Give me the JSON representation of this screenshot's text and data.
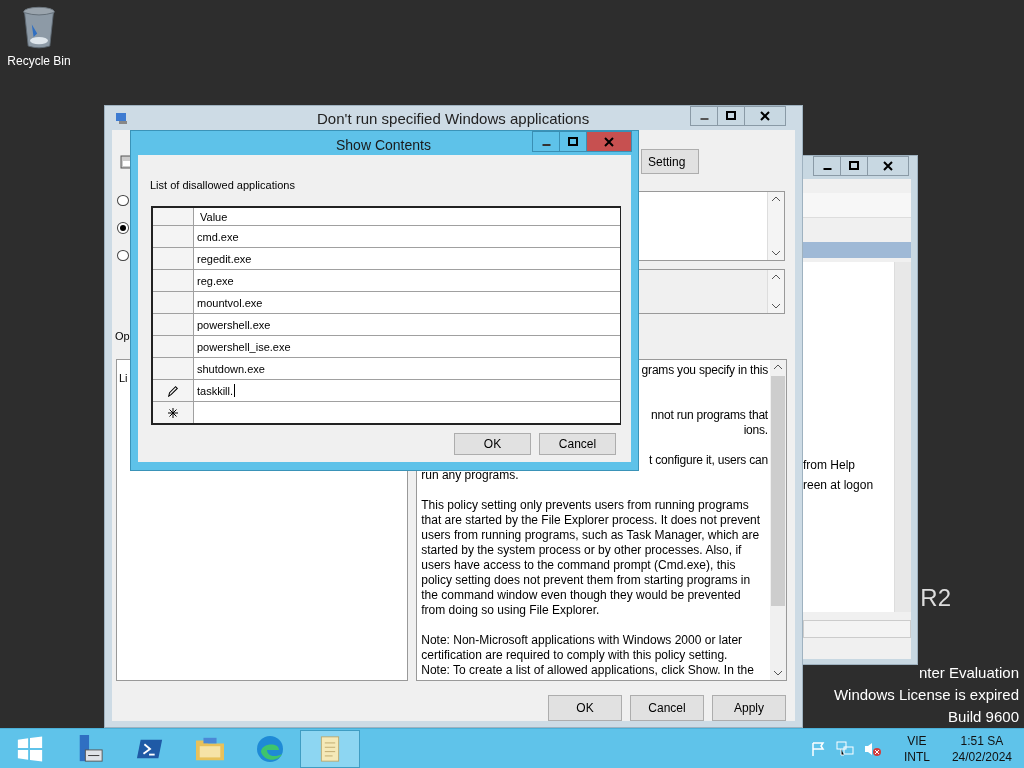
{
  "desktop": {
    "icons": [
      {
        "label": "Recycle Bin"
      }
    ],
    "os_notice": {
      "edition_tail": "R2",
      "edition": "nter Evaluation",
      "license": "Windows License is expired",
      "build": "Build 9600"
    }
  },
  "back_window": {
    "lines": [
      "from Help",
      "reen at logon"
    ]
  },
  "policy_window": {
    "title": "Don't run specified Windows applications",
    "setting_button": "Setting",
    "radios": [
      {
        "selected": false
      },
      {
        "selected": true
      },
      {
        "selected": false
      }
    ],
    "options_label": "Op",
    "options_text": "Li",
    "help_paragraphs": [
      {
        "lines": [
          {
            "text": "grams you specify in this",
            "cut": true
          }
        ]
      },
      {
        "lines": [
          {
            "text": "nnot run programs that",
            "cut": true
          },
          {
            "text": "ions.",
            "cut": true
          }
        ]
      },
      {
        "lines": [
          {
            "text": "t configure it, users can",
            "cut": true
          },
          {
            "text": "run any programs.",
            "cut": false
          }
        ]
      },
      {
        "lines": [
          {
            "text": "This policy setting only prevents users from running programs",
            "cut": false
          },
          {
            "text": "that are started by the File Explorer process. It does not prevent",
            "cut": false
          },
          {
            "text": "users from running programs, such as Task Manager, which are",
            "cut": false
          },
          {
            "text": "started by the system process or by other processes.  Also, if",
            "cut": false
          },
          {
            "text": "users have access to the command prompt (Cmd.exe), this",
            "cut": false
          },
          {
            "text": "policy setting does not prevent them from starting programs in",
            "cut": false
          },
          {
            "text": "the command window even though they would be prevented",
            "cut": false
          },
          {
            "text": "from doing so using File Explorer.",
            "cut": false
          }
        ]
      },
      {
        "lines": [
          {
            "text": "Note: Non-Microsoft applications with Windows 2000 or later",
            "cut": false
          },
          {
            "text": "certification are required to comply with this policy setting.",
            "cut": false
          },
          {
            "text": "Note: To create a list of allowed applications, click Show.  In the",
            "cut": false
          }
        ]
      }
    ],
    "buttons": [
      "OK",
      "Cancel",
      "Apply"
    ]
  },
  "dialog": {
    "title": "Show Contents",
    "label": "List of disallowed applications",
    "column": "Value",
    "rows": [
      {
        "value": "cmd.exe",
        "editing": false
      },
      {
        "value": "regedit.exe",
        "editing": false
      },
      {
        "value": "reg.exe",
        "editing": false
      },
      {
        "value": "mountvol.exe",
        "editing": false
      },
      {
        "value": "powershell.exe",
        "editing": false
      },
      {
        "value": "powershell_ise.exe",
        "editing": false
      },
      {
        "value": "shutdown.exe",
        "editing": false
      },
      {
        "value": "taskkill.",
        "editing": true
      }
    ],
    "new_row": true,
    "buttons": [
      "OK",
      "Cancel"
    ]
  },
  "taskbar": {
    "apps": [
      {
        "kind": "start",
        "active": false
      },
      {
        "kind": "server",
        "active": false
      },
      {
        "kind": "shell",
        "active": false
      },
      {
        "kind": "folder",
        "active": false
      },
      {
        "kind": "browser",
        "active": false
      },
      {
        "kind": "notes",
        "active": true
      }
    ],
    "volume_muted": true,
    "language": [
      "VIE",
      "INTL"
    ],
    "time": "1:51 SA",
    "date": "24/02/2024"
  }
}
